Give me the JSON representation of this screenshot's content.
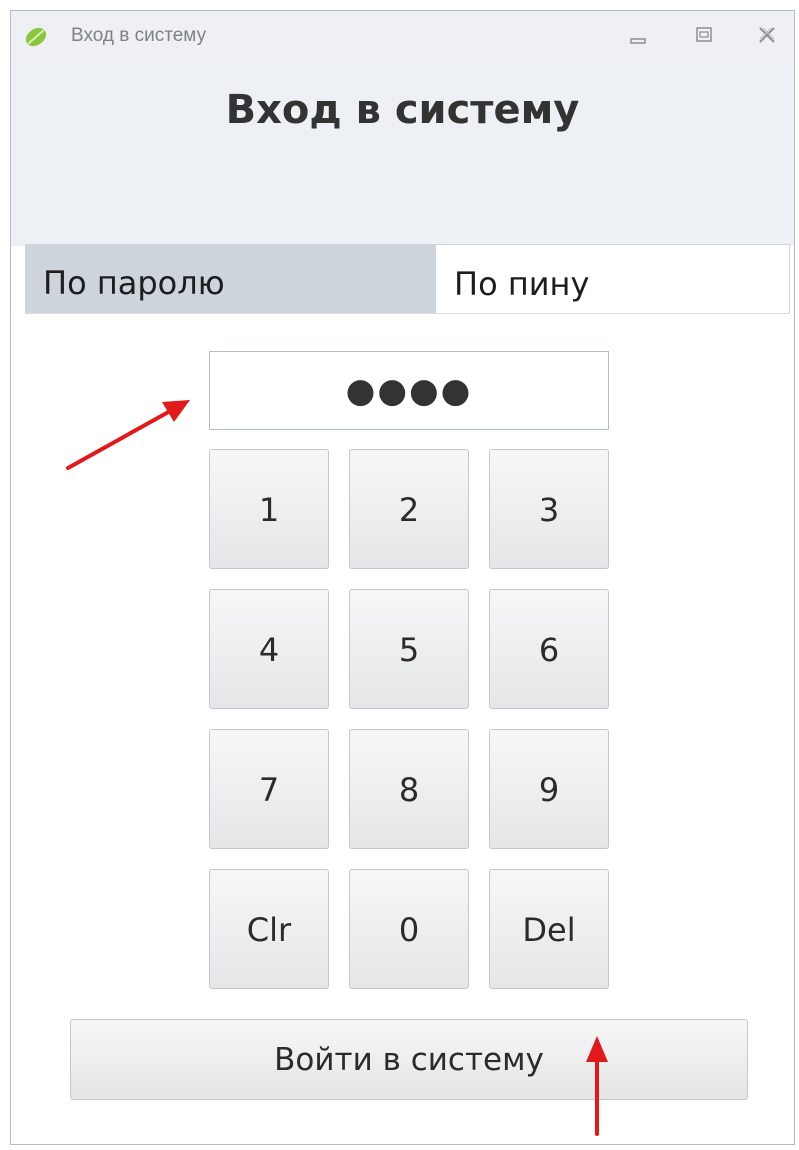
{
  "window": {
    "title": "Вход в систему",
    "icon": "leaf-icon"
  },
  "header": {
    "title": "Вход в систему"
  },
  "tabs": [
    {
      "label": "По паролю",
      "selected": true
    },
    {
      "label": "По пину",
      "selected": false
    }
  ],
  "pin": {
    "masked_value": "●●●●"
  },
  "keypad": {
    "keys": [
      "1",
      "2",
      "3",
      "4",
      "5",
      "6",
      "7",
      "8",
      "9",
      "Clr",
      "0",
      "Del"
    ]
  },
  "login_button": {
    "label": "Войти в систему"
  },
  "colors": {
    "accent_arrow": "#e0191b",
    "tab_selected": "#cdd4dc",
    "header_bg": "#edf0f4"
  }
}
